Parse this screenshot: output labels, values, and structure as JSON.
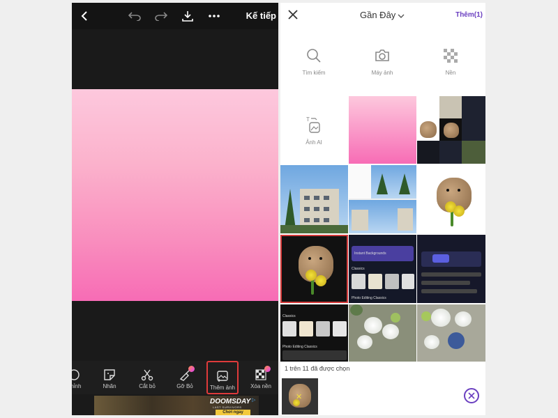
{
  "editor": {
    "next_label": "Kế tiếp",
    "tools": [
      {
        "label": "Chỉnh",
        "icon": "adjust-icon"
      },
      {
        "label": "Nhãn",
        "icon": "sticker-icon"
      },
      {
        "label": "Cắt bỏ",
        "icon": "scissors-icon"
      },
      {
        "label": "Gỡ Bỏ",
        "icon": "eraser-icon"
      },
      {
        "label": "Thêm ảnh",
        "icon": "add-photo-icon"
      },
      {
        "label": "Xóa nền",
        "icon": "remove-bg-icon"
      }
    ],
    "ad": {
      "brand": "DOOMSDAY",
      "subtitle": "LAST SURVIVORS",
      "cta": "Chơi ngay"
    }
  },
  "picker": {
    "title": "Gần Đây",
    "more_label": "Thêm(1)",
    "sources": [
      {
        "label": "Tìm kiếm",
        "icon": "search-icon"
      },
      {
        "label": "Máy ảnh",
        "icon": "camera-icon"
      },
      {
        "label": "Nền",
        "icon": "background-icon"
      },
      {
        "label": "Ảnh AI",
        "icon": "ai-photo-icon"
      }
    ],
    "thumb_texts": {
      "instant": "Instant Backgrounds",
      "classics": "Classics",
      "photo_editing": "Photo Editing Classics",
      "classics2": "Classics",
      "photo_editing2": "Photo Editing Classics"
    },
    "selected_text": "1 trên 11 đã được chọn"
  }
}
